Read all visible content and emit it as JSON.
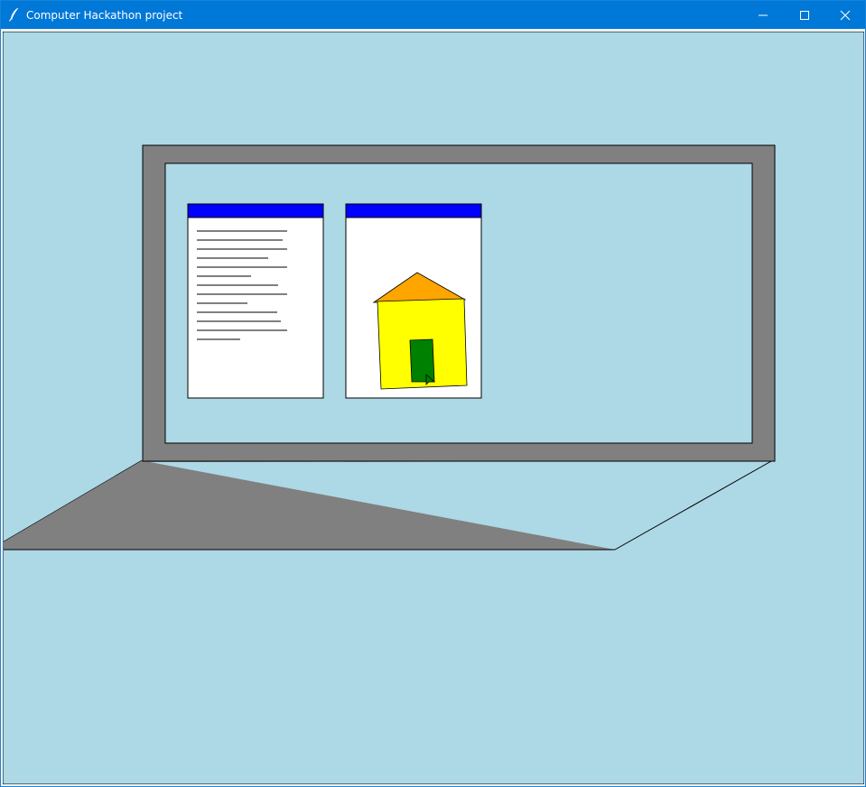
{
  "window": {
    "title": "Computer Hackathon project",
    "icon": "feather-icon",
    "controls": [
      "minimize-icon",
      "maximize-icon",
      "close-icon"
    ]
  },
  "colors": {
    "titlebar": "#0078d7",
    "canvas_background": "#add8e6",
    "laptop_body": "#808080",
    "window_titlebar": "#0000ff",
    "window_background": "#ffffff",
    "house_roof": "#ffa500",
    "house_wall": "#ffff00",
    "house_door": "#008000"
  },
  "scene": {
    "object": "laptop",
    "screen_windows": [
      {
        "name": "text-document-window",
        "content": "text lines"
      },
      {
        "name": "house-drawing-window",
        "content": "house drawing"
      }
    ]
  }
}
